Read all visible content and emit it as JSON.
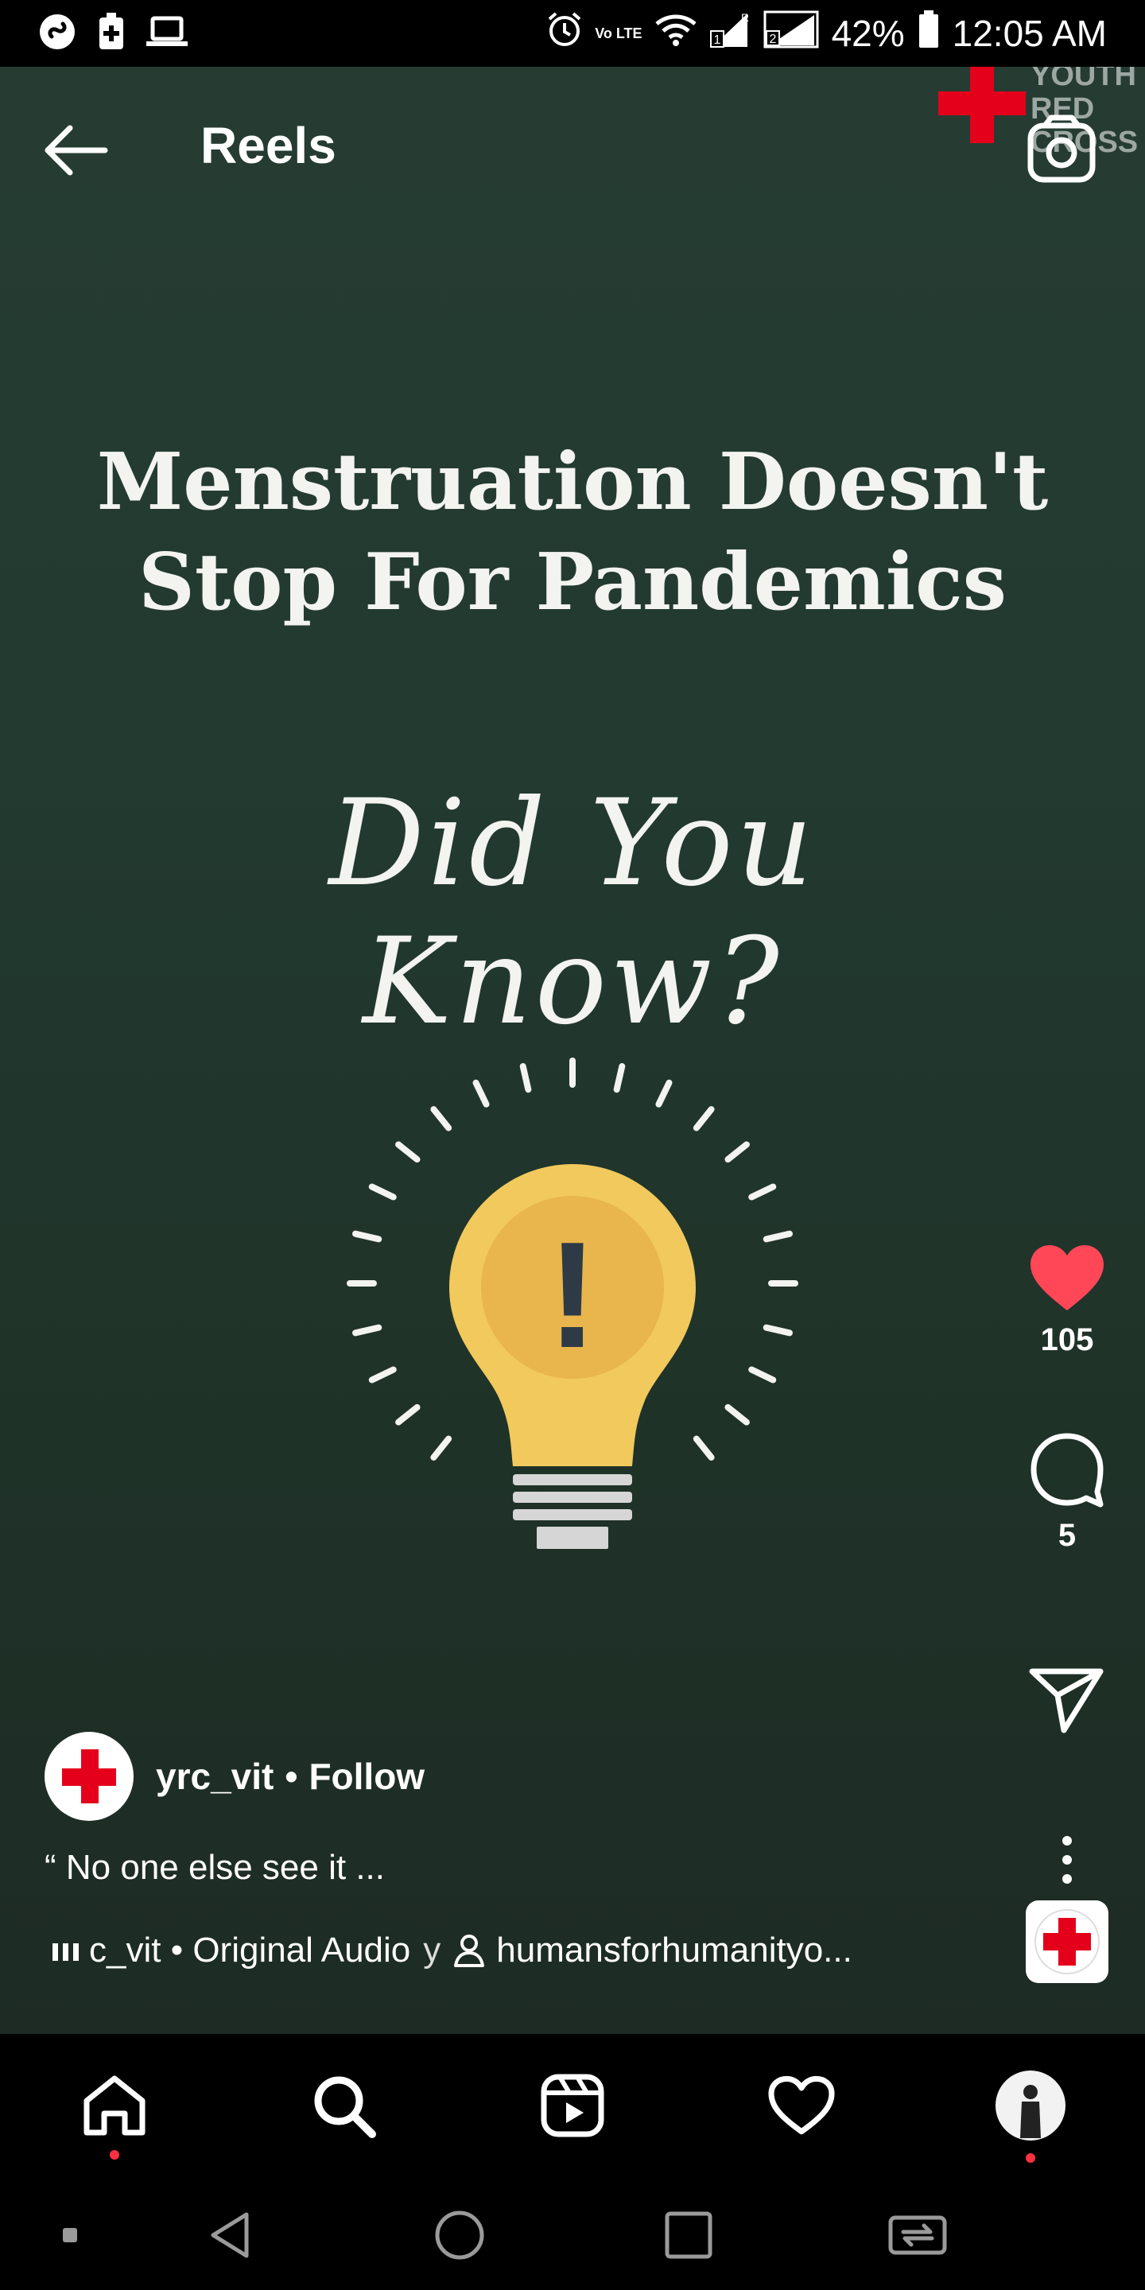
{
  "status_bar": {
    "battery_percent": "42%",
    "time": "12:05 AM",
    "network_label": "Vo LTE",
    "sim1_label": "1",
    "sim2_label": "2",
    "roaming_label": "R"
  },
  "header": {
    "title": "Reels"
  },
  "watermark": {
    "line1": "YOUTH",
    "line2": "RED",
    "line3": "CROSS"
  },
  "reel": {
    "headline_line1": "Menstruation Doesn't",
    "headline_line2": "Stop For Pandemics",
    "script_text": "Did You Know?",
    "bulb_mark": "!"
  },
  "actions": {
    "likes": "105",
    "comments": "5"
  },
  "author": {
    "username": "yrc_vit",
    "separator": "•",
    "follow_label": "Follow"
  },
  "caption": "“ No one else see it ...",
  "audio": {
    "source": "c_vit • Original Audio",
    "separator": "y",
    "tagged_user": "humansforhumanityo..."
  },
  "colors": {
    "like_red": "#ff4757",
    "cross_red": "#e4001b",
    "bulb_yellow": "#f1c95c",
    "reel_bg": "#223a30"
  }
}
